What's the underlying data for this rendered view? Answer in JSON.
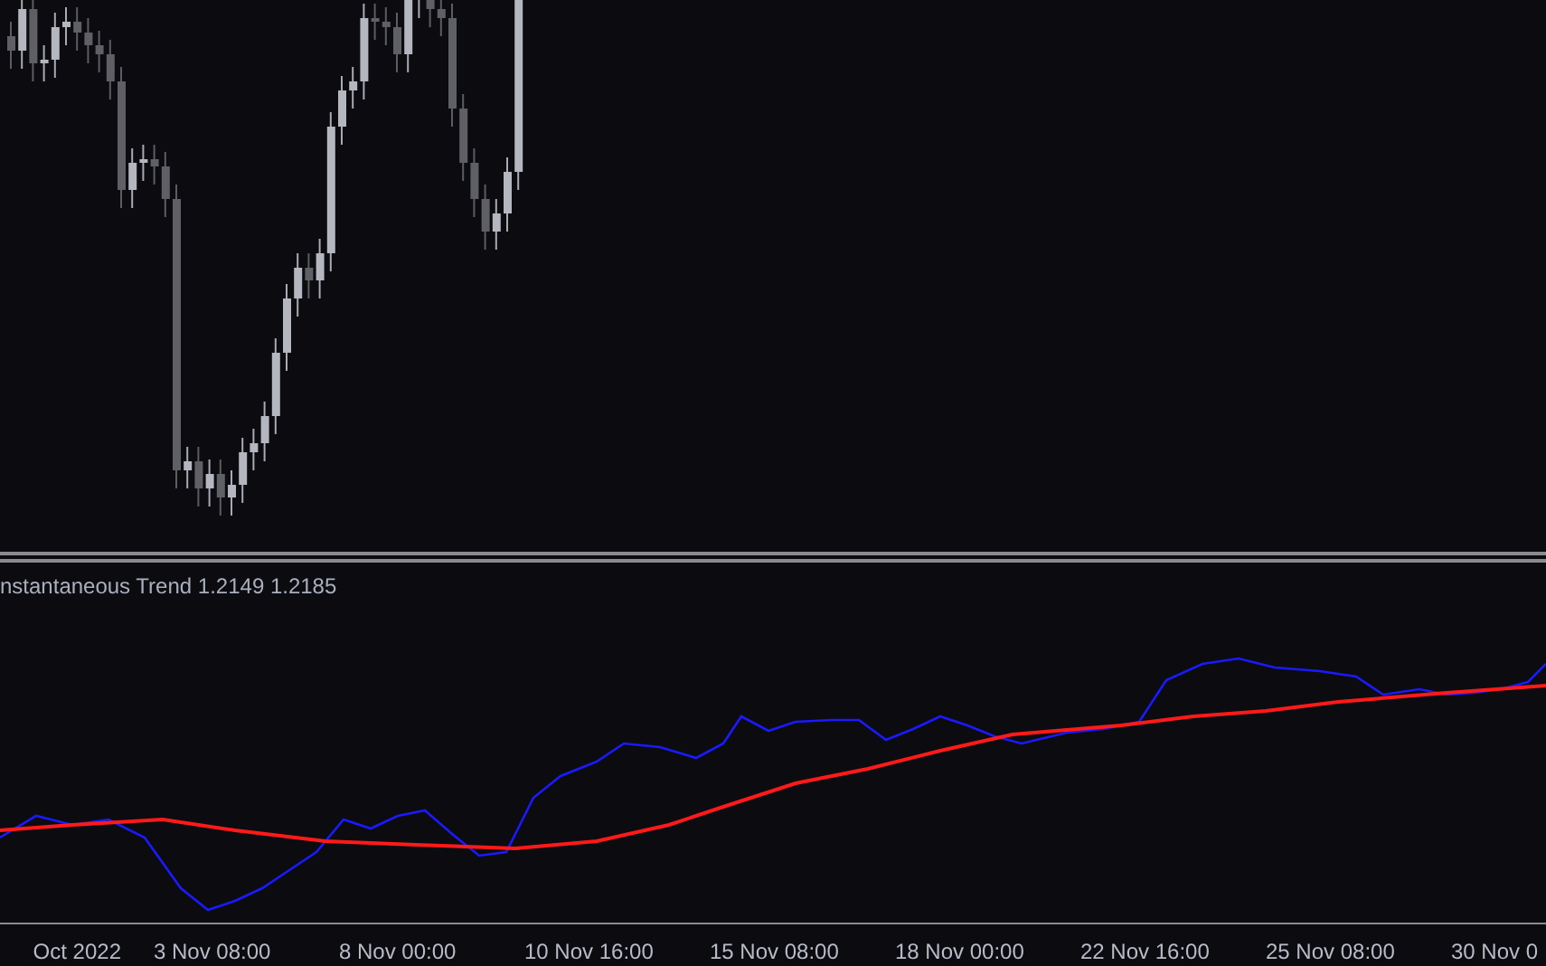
{
  "indicator": {
    "label": "nstantaneous Trend 1.2149 1.2185"
  },
  "time_axis": {
    "labels": [
      "Oct 2022",
      "3 Nov 08:00",
      "8 Nov 00:00",
      "10 Nov 16:00",
      "15 Nov 08:00",
      "18 Nov 00:00",
      "22 Nov 16:00",
      "25 Nov 08:00",
      "30 Nov 0"
    ]
  }
}
